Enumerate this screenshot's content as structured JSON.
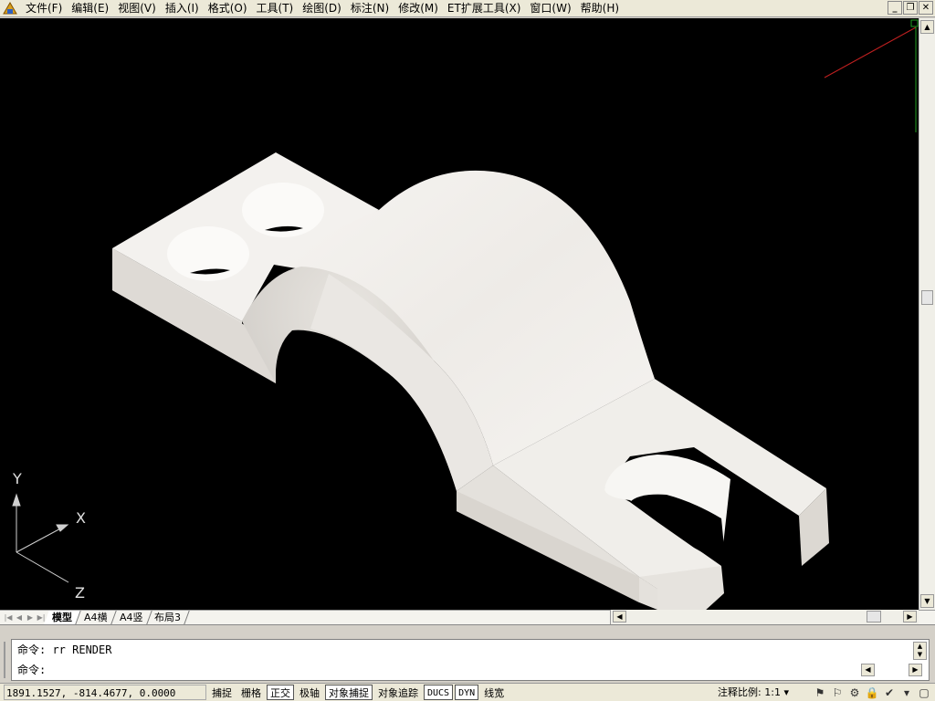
{
  "menubar": {
    "items": [
      "文件(F)",
      "编辑(E)",
      "视图(V)",
      "插入(I)",
      "格式(O)",
      "工具(T)",
      "绘图(D)",
      "标注(N)",
      "修改(M)",
      "ET扩展工具(X)",
      "窗口(W)",
      "帮助(H)"
    ]
  },
  "window_controls": {
    "minimize": "_",
    "restore": "❐",
    "close": "✕"
  },
  "ucs": {
    "x_label": "X",
    "y_label": "Y",
    "z_label": "Z"
  },
  "layout_tabs": {
    "tabs": [
      "模型",
      "A4横",
      "A4竖",
      "布局3"
    ],
    "active": "模型"
  },
  "command": {
    "history_line": "命令: rr RENDER",
    "prompt": "命令:"
  },
  "status": {
    "coordinates": "1891.1527, -814.4677, 0.0000",
    "toggles": [
      {
        "label": "捕捉",
        "on": false
      },
      {
        "label": "栅格",
        "on": false
      },
      {
        "label": "正交",
        "on": true
      },
      {
        "label": "极轴",
        "on": false
      },
      {
        "label": "对象捕捉",
        "on": true
      },
      {
        "label": "对象追踪",
        "on": false
      },
      {
        "label": "DUCS",
        "on": true
      },
      {
        "label": "DYN",
        "on": true
      },
      {
        "label": "线宽",
        "on": false
      }
    ],
    "annotation_scale_label": "注释比例:",
    "annotation_scale_value": "1:1"
  },
  "colors": {
    "viewport_bg": "#000000",
    "model_face": "#f2f0ec",
    "model_shadow": "#c9c5c0"
  }
}
